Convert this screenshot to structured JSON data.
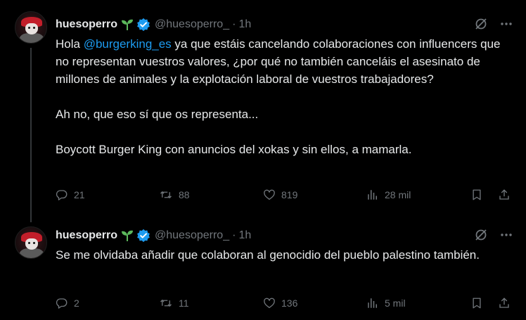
{
  "tweets": [
    {
      "name": "huesoperro",
      "handle": "@huesoperro_",
      "dot": "·",
      "time": "1h",
      "text": {
        "p1_before": "Hola ",
        "p1_mention": "@burgerking_es",
        "p1_after": " ya que estáis cancelando colaboraciones con influencers que no representan vuestros valores, ¿por qué no también canceláis el asesinato de millones de animales y la explotación laboral de vuestros trabajadores?",
        "p2": "Ah no, que eso sí que os representa...",
        "p3": "Boycott Burger King con anuncios del xokas y sin ellos, a mamarla."
      },
      "stats": {
        "replies": "21",
        "reposts": "88",
        "likes": "819",
        "views": "28 mil"
      }
    },
    {
      "name": "huesoperro",
      "handle": "@huesoperro_",
      "dot": "·",
      "time": "1h",
      "text": {
        "p1": "Se me olvidaba añadir que colaboran al genocidio del pueblo palestino también."
      },
      "stats": {
        "replies": "2",
        "reposts": "11",
        "likes": "136",
        "views": "5 mil"
      }
    }
  ],
  "colors": {
    "background": "#000000",
    "text": "#e7e9ea",
    "muted": "#71767b",
    "link": "#1d9bf0",
    "verified": "#1d9bf0",
    "sprout": "#5cb85c"
  },
  "icons": [
    "sprout-icon",
    "verified-badge-icon",
    "grok-icon",
    "more-icon",
    "reply-icon",
    "repost-icon",
    "like-icon",
    "views-icon",
    "bookmark-icon",
    "share-icon"
  ]
}
